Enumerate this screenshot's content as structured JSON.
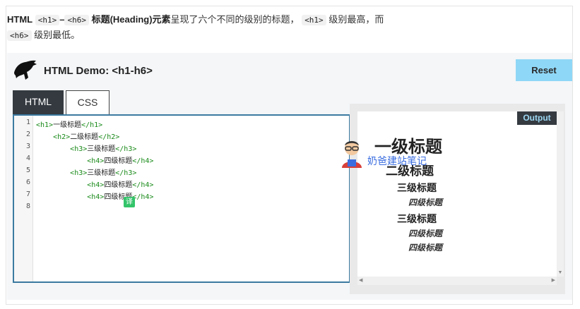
{
  "intro": {
    "prefix": "HTML",
    "chip_h1": "<h1>",
    "dash": "–",
    "chip_h6": "<h6>",
    "bold_rest": "标题(Heading)元素",
    "text1": "呈现了六个不同的级别的标题，",
    "chip_h1b": "<h1>",
    "text2": "级别最高，而",
    "chip_h6b": "<h6>",
    "text3": "级别最低。"
  },
  "demo": {
    "title": "HTML Demo: <h1-h6>",
    "logo_icon": "dinosaur-logo-icon",
    "reset_label": "Reset",
    "tabs": [
      {
        "label": "HTML",
        "active": true
      },
      {
        "label": "CSS",
        "active": false
      }
    ]
  },
  "editor": {
    "line_numbers": [
      "1",
      "2",
      "3",
      "4",
      "5",
      "6",
      "7",
      "8"
    ],
    "lines": [
      {
        "indent": "",
        "open": "<h1>",
        "text": "一级标题",
        "close": "</h1>"
      },
      {
        "indent": "    ",
        "open": "<h2>",
        "text": "二级标题",
        "close": "</h2>"
      },
      {
        "indent": "        ",
        "open": "<h3>",
        "text": "三级标题",
        "close": "</h3>"
      },
      {
        "indent": "            ",
        "open": "<h4>",
        "text": "四级标题",
        "close": "</h4>"
      },
      {
        "indent": "        ",
        "open": "<h3>",
        "text": "三级标题",
        "close": "</h3>"
      },
      {
        "indent": "            ",
        "open": "<h4>",
        "text": "四级标题",
        "close": "</h4>"
      },
      {
        "indent": "            ",
        "open": "<h4>",
        "text": "四级标题",
        "close": "</h4>"
      },
      {
        "indent": "",
        "open": "",
        "text": "",
        "close": ""
      }
    ],
    "translate_badge": "译"
  },
  "output": {
    "label": "Output",
    "h1": "一级标题",
    "h2": "二级标题",
    "h3a": "三级标题",
    "h4a": "四级标题",
    "h3b": "三级标题",
    "h4b": "四级标题",
    "h4c": "四级标题"
  },
  "watermark": {
    "text": "奶爸建站笔记",
    "icon": "avatar-icon"
  },
  "colors": {
    "reset_bg": "#8fd7f7",
    "tab_active_bg": "#343a40",
    "editor_border": "#3b7aa0",
    "tag_green": "#1a8a1a",
    "output_label": "#9cd6f2",
    "watermark_blue": "#3a6de0"
  }
}
